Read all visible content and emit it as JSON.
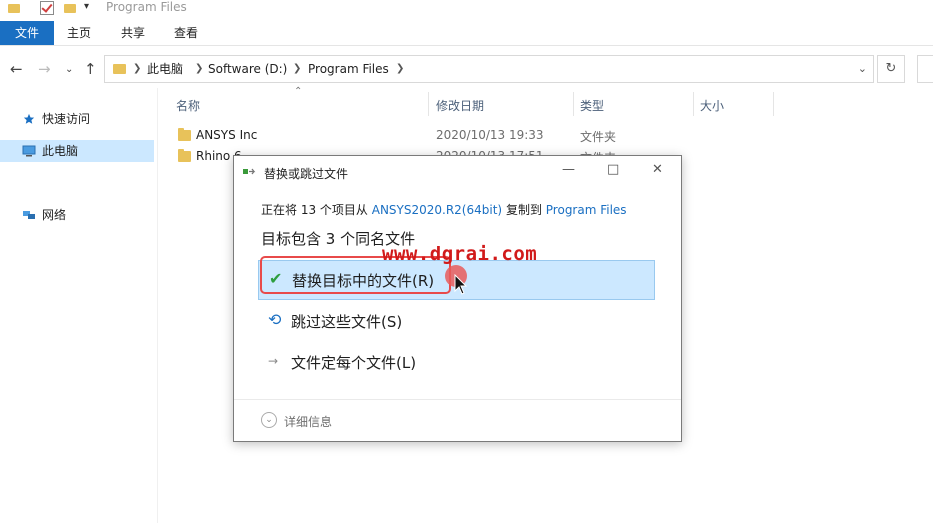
{
  "window": {
    "title": "Program Files"
  },
  "ribbon": {
    "tabs": [
      "文件",
      "主页",
      "共享",
      "查看"
    ]
  },
  "address": {
    "crumbs": [
      "此电脑",
      "Software (D:)",
      "Program Files"
    ]
  },
  "nav": {
    "quick_access": "快速访问",
    "this_pc": "此电脑",
    "network": "网络"
  },
  "columns": {
    "name": "名称",
    "date": "修改日期",
    "type": "类型",
    "size": "大小"
  },
  "files": [
    {
      "name": "ANSYS Inc",
      "date": "2020/10/13 19:33",
      "type": "文件夹"
    },
    {
      "name": "Rhino 6",
      "date": "2020/10/13 17:51",
      "type": "文件夹"
    }
  ],
  "dialog": {
    "title": "替换或跳过文件",
    "desc_prefix": "正在将 13 个项目从",
    "source": "ANSYS2020.R2(64bit)",
    "desc_mid": "复制到",
    "dest": "Program Files",
    "heading": "目标包含 3 个同名文件",
    "options": {
      "replace": "替换目标中的文件(R)",
      "skip": "跳过这些文件(S)",
      "decide": "文件定每个文件(L)"
    },
    "details": "详细信息"
  },
  "watermark": "www.dgrai.com",
  "colors": {
    "accent": "#1a6fc2",
    "selection": "#cce8ff",
    "highlight_border": "#e84a4a",
    "folder": "#e8c25a"
  }
}
